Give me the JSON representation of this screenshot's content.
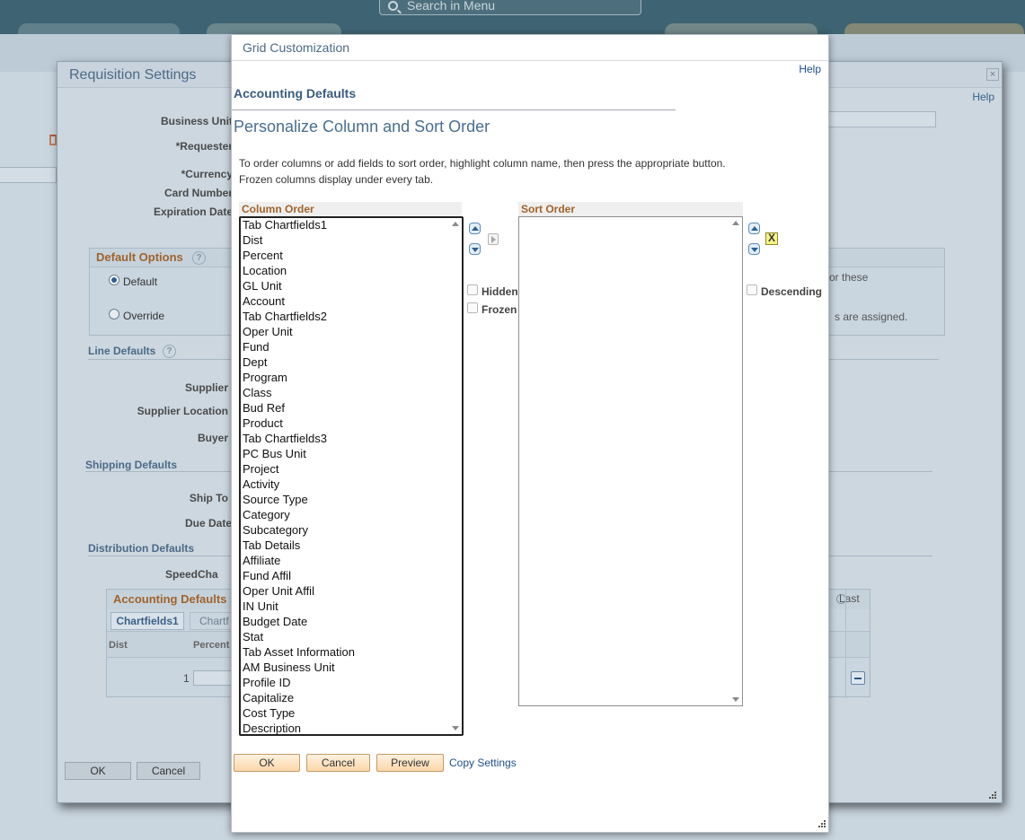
{
  "banner": {
    "search_placeholder": "Search in Menu"
  },
  "requisition_dialog": {
    "title": "Requisition Settings",
    "help": "Help",
    "close": "×",
    "labels": {
      "business_unit": "Business Unit",
      "requester": "*Requester",
      "currency": "*Currency",
      "card_number": "Card Number",
      "expiration_date": "Expiration Date",
      "supplier": "Supplier",
      "supplier_location": "Supplier Location",
      "buyer": "Buyer",
      "ship_to": "Ship To",
      "due_date": "Due Date",
      "speedchart": "SpeedCha"
    },
    "sections": {
      "default_options": "Default Options",
      "line_defaults": "Line Defaults",
      "shipping_defaults": "Shipping Defaults",
      "distribution_defaults": "Distribution Defaults"
    },
    "radio_default": "Default",
    "radio_override": "Override",
    "default_options_text_1": "or these",
    "default_options_text_2": "s are assigned.",
    "accounting_defaults": {
      "title": "Accounting Defaults",
      "tab_chartfields1": "Chartfields1",
      "tab_chartfields2": "Chartf",
      "col_dist": "Dist",
      "col_percent": "Percent",
      "row_number": "1",
      "last_label": "Last"
    },
    "ok": "OK",
    "cancel": "Cancel"
  },
  "modal": {
    "title": "Grid Customization",
    "help": "Help",
    "subtitle": "Accounting Defaults",
    "heading": "Personalize Column and Sort Order",
    "instruction_1": "To order columns or add fields to sort order, highlight column name, then press the appropriate button.",
    "instruction_2": "Frozen columns display under every tab.",
    "column_order_label": "Column Order",
    "sort_order_label": "Sort Order",
    "columns": [
      "Tab Chartfields1",
      "Dist",
      "Percent",
      "Location",
      "GL Unit",
      "Account",
      "Tab Chartfields2",
      "Oper Unit",
      "Fund",
      "Dept",
      "Program",
      "Class",
      "Bud Ref",
      "Product",
      "Tab Chartfields3",
      "PC Bus Unit",
      "Project",
      "Activity",
      "Source Type",
      "Category",
      "Subcategory",
      "Tab Details",
      "Affiliate",
      "Fund Affil",
      "Oper Unit Affil",
      "IN Unit",
      "Budget Date",
      "Stat",
      "Tab Asset Information",
      "AM Business Unit",
      "Profile ID",
      "Capitalize",
      "Cost Type",
      "Description"
    ],
    "hidden_label": "Hidden",
    "frozen_label": "Frozen",
    "descending_label": "Descending",
    "remove_symbol": "X",
    "buttons": {
      "ok": "OK",
      "cancel": "Cancel",
      "preview": "Preview",
      "copy_settings": "Copy Settings"
    }
  },
  "colors": {
    "banner": "#3e6372",
    "heading_blue": "#4b6d91",
    "column_header_text": "#a0632b",
    "button_orange": "#fbd7a9"
  }
}
